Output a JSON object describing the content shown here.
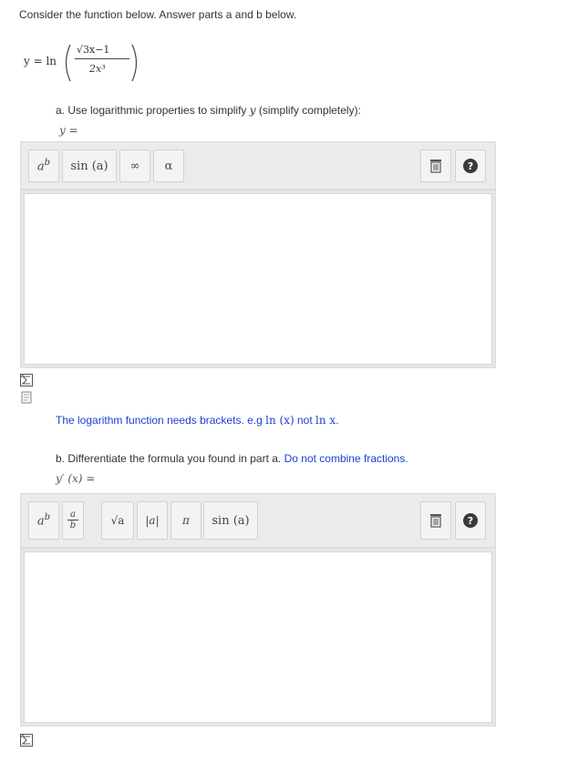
{
  "intro": "Consider the function below. Answer parts a and b below.",
  "function": {
    "lhs": "y = ln",
    "numerator": "√3x−1",
    "denominator": "2x³"
  },
  "part_a": {
    "prompt_prefix": "a.  Use logarithmic properties to simplify",
    "prompt_var": "y",
    "prompt_suffix": "(simplify completely):",
    "answer_label": "y =",
    "toolbar": {
      "btn_power": "a^b",
      "btn_sin": "sin (a)",
      "btn_inf": "∞",
      "btn_alpha": "α"
    },
    "note_prefix": "The logarithm function needs brackets. e.g",
    "note_good": "ln (x)",
    "note_mid": "not",
    "note_bad": "ln  x",
    "note_end": "."
  },
  "part_b": {
    "prompt": "b.  Differentiate the formula you found in part a.",
    "prompt_blue": "Do not combine fractions.",
    "answer_label": "y′ (x) =",
    "toolbar": {
      "btn_power": "a^b",
      "btn_frac_num": "a",
      "btn_frac_den": "b",
      "btn_sqrt": "√a",
      "btn_abs": "|a|",
      "btn_pi": "π",
      "btn_sin": "sin (a)"
    }
  },
  "icons": {
    "help": "?"
  }
}
